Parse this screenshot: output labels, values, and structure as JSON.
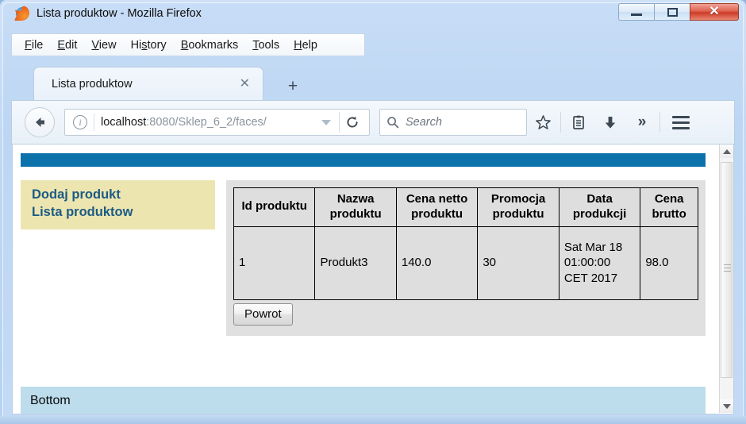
{
  "window": {
    "title": "Lista produktow - Mozilla Firefox",
    "logo_icon": "firefox-logo-icon",
    "controls": {
      "minimize": "minimize-icon",
      "maximize": "maximize-icon",
      "close": "✕"
    }
  },
  "menubar": {
    "items": [
      {
        "pre": "",
        "accel": "F",
        "post": "ile"
      },
      {
        "pre": "",
        "accel": "E",
        "post": "dit"
      },
      {
        "pre": "",
        "accel": "V",
        "post": "iew"
      },
      {
        "pre": "Hi",
        "accel": "s",
        "post": "tory"
      },
      {
        "pre": "",
        "accel": "B",
        "post": "ookmarks"
      },
      {
        "pre": "",
        "accel": "T",
        "post": "ools"
      },
      {
        "pre": "",
        "accel": "H",
        "post": "elp"
      }
    ]
  },
  "tabs": {
    "active_label": "Lista produktow",
    "close_glyph": "✕",
    "newtab_glyph": "+"
  },
  "navbar": {
    "back_icon": "back-arrow-icon",
    "site_info_icon": "info-icon",
    "url_host": "localhost",
    "url_path": ":8080/Sklep_6_2/faces/",
    "reload_icon": "reload-icon",
    "search_placeholder": "Search",
    "search_icon": "search-icon",
    "bookmark_icon": "star-icon",
    "library_icon": "library-icon",
    "downloads_icon": "download-arrow-icon",
    "overflow_glyph": "»",
    "menu_icon": "hamburger-menu-icon"
  },
  "page": {
    "accent_color": "#0b72ac",
    "sidebar": {
      "background_color": "#ede5b0",
      "link_color": "#1b5b84",
      "links": [
        "Dodaj produkt",
        "Lista produktow"
      ]
    },
    "table": {
      "headers": [
        "Id produktu",
        "Nazwa produktu",
        "Cena netto produktu",
        "Promocja produktu",
        "Data produkcji",
        "Cena brutto"
      ],
      "rows": [
        [
          "1",
          "Produkt3",
          "140.0",
          "30",
          "Sat Mar 18 01:00:00 CET 2017",
          "98.0"
        ]
      ]
    },
    "back_button_label": "Powrot",
    "footer_label": "Bottom",
    "footer_color": "#bddcec"
  },
  "scrollbar": {
    "up_arrow": "scroll-up-icon",
    "down_arrow": "scroll-down-icon"
  }
}
